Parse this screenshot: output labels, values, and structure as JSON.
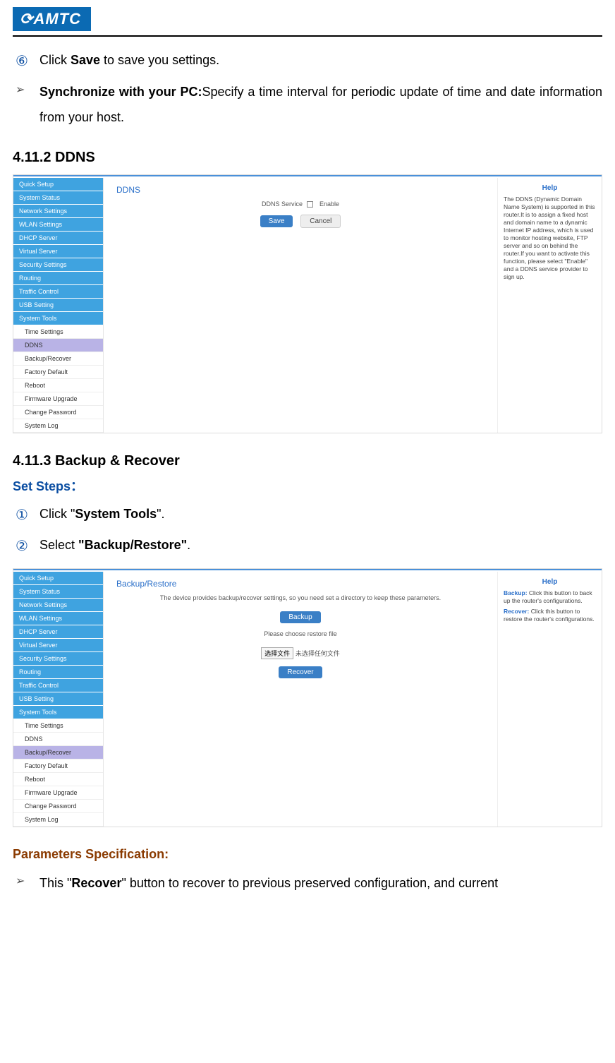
{
  "logo_text": "AMTC",
  "top_items": {
    "circ6": "⑥",
    "item6_pre": "Click ",
    "item6_bold": "Save",
    "item6_post": " to save you settings.",
    "tri": "➢",
    "sync_bold": "Synchronize with your PC:",
    "sync_rest": "Specify a time interval for periodic update of time and date information from your host."
  },
  "h_ddns": "4.11.2 DDNS",
  "ddns_shot": {
    "side_top": [
      "Quick Setup",
      "System Status",
      "Network Settings",
      "WLAN Settings",
      "DHCP Server",
      "Virtual Server",
      "Security Settings",
      "Routing",
      "Traffic Control",
      "USB Setting",
      "System Tools"
    ],
    "side_sub": [
      "Time Settings",
      "DDNS",
      "Backup/Recover",
      "Factory Default",
      "Reboot",
      "Firmware Upgrade",
      "Change Password",
      "System Log"
    ],
    "selected": "DDNS",
    "panel_title": "DDNS",
    "row_label": "DDNS Service",
    "row_chk": "Enable",
    "btn_save": "Save",
    "btn_cancel": "Cancel",
    "help_title": "Help",
    "help_text": "The DDNS (Dynamic Domain Name System) is supported in this router.It is to assign a fixed host and domain name to a dynamic Internet IP address, which is used to monitor hosting website, FTP server and so on behind the router.If you want to activate this function, please select \"Enable\" and a DDNS service provider to sign up."
  },
  "h_backup": "4.11.3 Backup & Recover",
  "setsteps": "Set Steps：",
  "step1": {
    "circ": "①",
    "pre": "Click \"",
    "bold": "System Tools",
    "post": "\"."
  },
  "step2": {
    "circ": "②",
    "pre": "Select ",
    "bold": "\"Backup/Restore\"",
    "post": "."
  },
  "backup_shot": {
    "side_top": [
      "Quick Setup",
      "System Status",
      "Network Settings",
      "WLAN Settings",
      "DHCP Server",
      "Virtual Server",
      "Security Settings",
      "Routing",
      "Traffic Control",
      "USB Setting",
      "System Tools"
    ],
    "side_sub": [
      "Time Settings",
      "DDNS",
      "Backup/Recover",
      "Factory Default",
      "Reboot",
      "Firmware Upgrade",
      "Change Password",
      "System Log"
    ],
    "selected": "Backup/Recover",
    "panel_title": "Backup/Restore",
    "desc": "The device provides backup/recover settings, so you need set a directory to keep these parameters.",
    "btn_backup": "Backup",
    "restore_label": "Please choose restore file",
    "file_btn": "选择文件",
    "file_none": "未选择任何文件",
    "btn_recover": "Recover",
    "help_title": "Help",
    "help_b_key": "Backup:",
    "help_b_txt": " Click this button to back up the router's configurations.",
    "help_r_key": "Recover:",
    "help_r_txt": " Click this button to restore the router's configurations."
  },
  "paramspec": "Parameters Specification:",
  "last": {
    "tri": "➢",
    "pre": "This \"",
    "bold": "Recover",
    "post": "\" button to recover to previous preserved configuration, and current"
  }
}
